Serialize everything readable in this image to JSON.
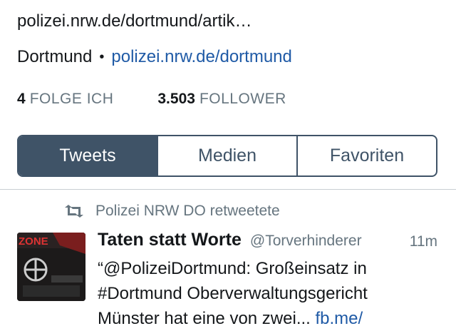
{
  "profile": {
    "link_line": "polizei.nrw.de/dortmund/artik…",
    "location": "Dortmund",
    "separator": "•",
    "website": "polizei.nrw.de/dortmund"
  },
  "stats": {
    "following_count": "4",
    "following_label": "FOLGE ICH",
    "followers_count": "3.503",
    "followers_label": "FOLLOWER"
  },
  "tabs": [
    {
      "label": "Tweets",
      "active": true
    },
    {
      "label": "Medien",
      "active": false
    },
    {
      "label": "Favoriten",
      "active": false
    }
  ],
  "tweet": {
    "retweet_text": "Polizei NRW DO retweetete",
    "display_name": "Taten statt Worte",
    "handle": "@Torverhinderer",
    "time": "11m",
    "text_line1": "“@PolizeiDortmund: Großeinsatz in",
    "text_line2": "#Dortmund Oberverwaltungsgericht",
    "text_line3_prefix": "Münster hat eine von zwei... ",
    "text_link": "fb.me/",
    "avatar_text": "ZONE"
  },
  "icons": {
    "retweet": "retweet-icon"
  },
  "colors": {
    "accent_dark": "#3f5367",
    "link": "#1f5aa6",
    "muted": "#66757f"
  }
}
